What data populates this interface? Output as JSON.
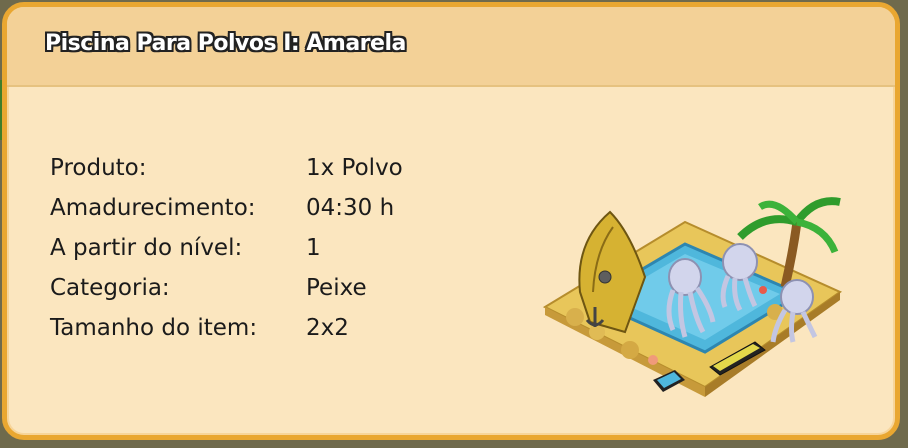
{
  "title": "Piscina Para Polvos I: Amarela",
  "rows": [
    {
      "label": "Produto:",
      "value": "1x Polvo"
    },
    {
      "label": "Amadurecimento:",
      "value": "04:30 h"
    },
    {
      "label": "A partir do nível:",
      "value": "1"
    },
    {
      "label": "Categoria:",
      "value": "Peixe"
    },
    {
      "label": "Tamanho do item:",
      "value": "2x2"
    }
  ],
  "colors": {
    "panel_border": "#e9a731",
    "panel_bg": "#fbe6bf",
    "header_bg": "#f3d197"
  },
  "illustration": "octopus-pool-icon"
}
